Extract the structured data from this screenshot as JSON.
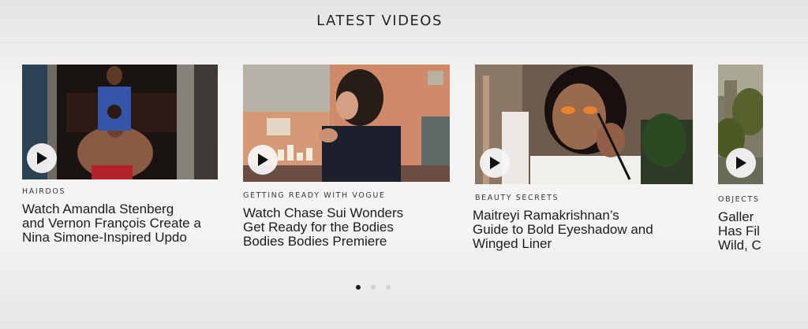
{
  "section": {
    "title": "LATEST VIDEOS"
  },
  "cards": [
    {
      "kicker": "HAIRDOS",
      "headline": "Watch Amandla Stenberg\nand Vernon François Create a\nNina Simone-Inspired Updo"
    },
    {
      "kicker": "GETTING READY WITH VOGUE",
      "headline": "Watch Chase Sui Wonders\nGet Ready for the Bodies\nBodies Bodies Premiere"
    },
    {
      "kicker": "BEAUTY SECRETS",
      "headline": "Maitreyi Ramakrishnan’s\nGuide to Bold Eyeshadow and\nWinged Liner"
    },
    {
      "kicker": "OBJECTS",
      "headline": "Galler\nHas Fil\nWild, C"
    }
  ],
  "pagination": {
    "count": 3,
    "active_index": 0
  },
  "icons": {
    "play": "play-icon"
  },
  "colors": {
    "background": "#f3f3f1",
    "text": "#1c1c1c",
    "dot_active": "#1a1a1a",
    "dot_inactive": "#d2d2d0"
  }
}
